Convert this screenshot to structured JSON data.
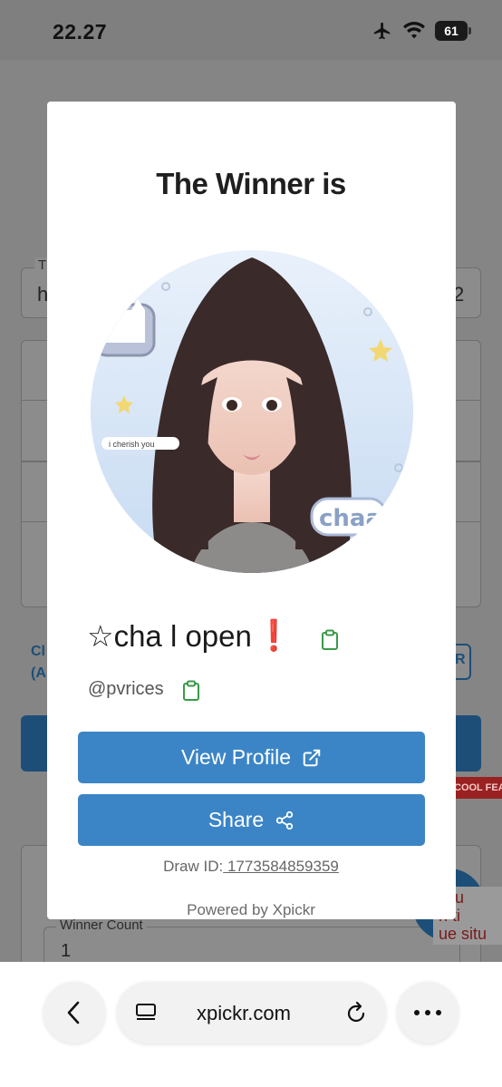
{
  "status": {
    "time": "22.27",
    "battery": "61"
  },
  "background": {
    "field_prefix": "h",
    "field_suffix": "2",
    "field_top_label": "T",
    "link_left": "Cl\n(A",
    "link_right": "R",
    "red_badge": "COOL FEA",
    "winner_count_label": "Winner Count",
    "winner_count_value": "1",
    "snippet_text": "R u\nn ti\nue situ"
  },
  "modal": {
    "title": "The Winner is",
    "winner_name": "☆cha l open",
    "winner_exclaim": "❗",
    "handle": "@pvrices",
    "view_profile_label": "View Profile",
    "share_label": "Share",
    "draw_id_label": "Draw ID:",
    "draw_id_value": " 1773584859359",
    "powered_by": "Powered by Xpickr",
    "avatar_caption": "i cherish you",
    "avatar_sticker": "chaa"
  },
  "browser": {
    "url": "xpickr.com"
  },
  "colors": {
    "accent": "#3b85c6",
    "copy_icon": "#3a9a4a",
    "exclaim": "#d8232a"
  }
}
